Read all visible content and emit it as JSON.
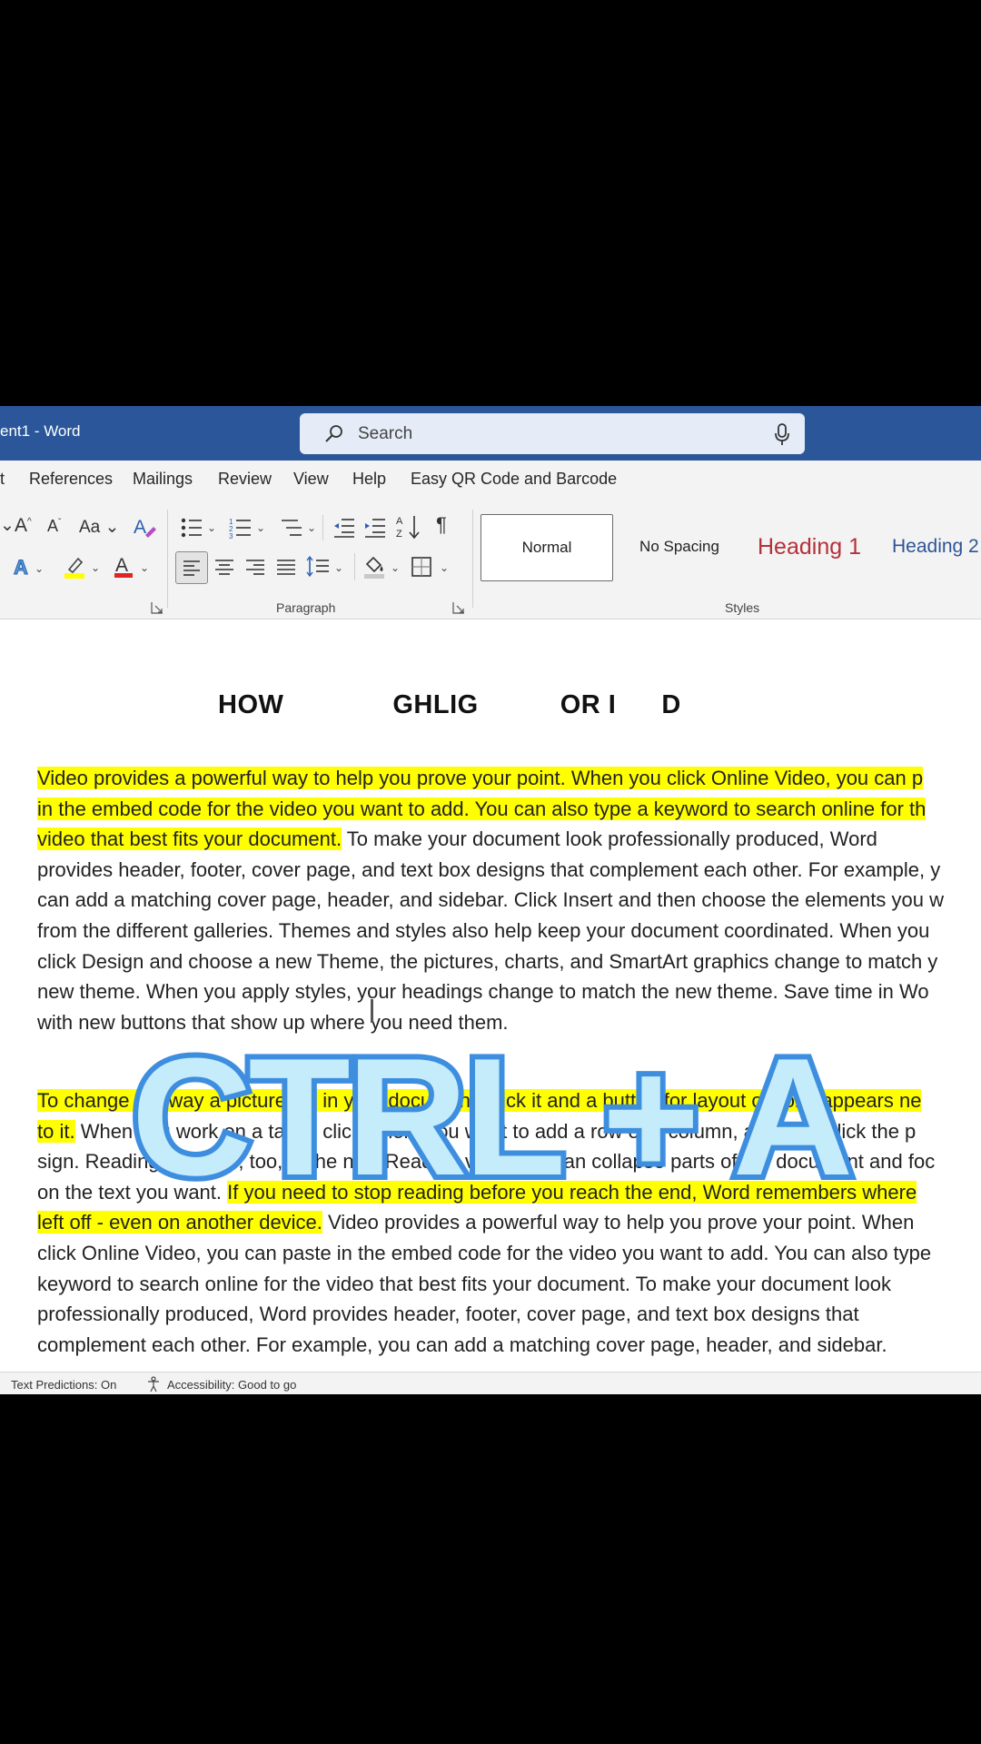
{
  "app": {
    "title": "ent1  -  Word",
    "search_placeholder": "Search"
  },
  "menu": {
    "tabs": [
      "t",
      "References",
      "Mailings",
      "Review",
      "View",
      "Help",
      "Easy QR Code and Barcode"
    ]
  },
  "ribbon": {
    "font_group": {
      "grow_font": "A",
      "shrink_font": "A",
      "change_case": "Aa",
      "font_color_letter": "A"
    },
    "paragraph_label": "Paragraph",
    "styles_label": "Styles",
    "styles": [
      "Normal",
      "No Spacing",
      "Heading 1",
      "Heading 2"
    ]
  },
  "document": {
    "heading_fragments": [
      "HOW",
      "GHLIG",
      "OR I",
      "D"
    ],
    "paragraph1": [
      [
        {
          "t": "Video provides a powerful way to help you prove your point. When you click Online Video, you can p",
          "h": true
        }
      ],
      [
        {
          "t": "in the embed code for the video you want to add. You can also type a keyword to search online for th",
          "h": true
        }
      ],
      [
        {
          "t": "video that best fits your document.",
          "h": true
        },
        {
          "t": " To make your document look professionally produced, Word",
          "h": false
        }
      ],
      [
        {
          "t": "provides header, footer, cover page, and text box designs that complement each other. For example, y",
          "h": false
        }
      ],
      [
        {
          "t": "can add a matching cover page, header, and sidebar. Click Insert and then choose the elements you w",
          "h": false
        }
      ],
      [
        {
          "t": "from the different galleries. Themes and styles also help keep your document coordinated. When you",
          "h": false
        }
      ],
      [
        {
          "t": "click Design and choose a new Theme, the pictures, charts, and SmartArt graphics change to match y",
          "h": false
        }
      ],
      [
        {
          "t": "new theme. When you apply styles, your headings change to match the new theme. Save time in Wo",
          "h": false
        }
      ],
      [
        {
          "t": "with new buttons that show up where you need them.",
          "h": false
        }
      ]
    ],
    "paragraph2": [
      [
        {
          "t": "To change the way a picture fits in your document, click it and a button for layout options appears ne",
          "h": true
        }
      ],
      [
        {
          "t": "to it.",
          "h": true
        },
        {
          "t": " When you work on a table, click where you want to add a row or a column, and then click the p",
          "h": false
        }
      ],
      [
        {
          "t": "sign. Reading is easier, too, in the new Reading view. You can collapse parts of the document and foc",
          "h": false
        }
      ],
      [
        {
          "t": "on the text you want. ",
          "h": false
        },
        {
          "t": "If you need to stop reading before you reach the end, Word remembers where",
          "h": true
        }
      ],
      [
        {
          "t": "left off - even on another device.",
          "h": true
        },
        {
          "t": " Video provides a powerful way to help you prove your point. When",
          "h": false
        }
      ],
      [
        {
          "t": "click Online Video, you can paste in the embed code for the video you want to add. You can also type",
          "h": false
        }
      ],
      [
        {
          "t": "keyword to search online for the video that best fits your document. To make your document look",
          "h": false
        }
      ],
      [
        {
          "t": "professionally produced, Word provides header, footer, cover page, and text box designs that",
          "h": false
        }
      ],
      [
        {
          "t": "complement each other. For example, you can add a matching cover page, header, and sidebar.",
          "h": false
        }
      ]
    ]
  },
  "overlay": {
    "caption": "CTRL + A"
  },
  "statusbar": {
    "text_predictions": "Text Predictions: On",
    "accessibility": "Accessibility: Good to go"
  },
  "colors": {
    "titlebar": "#2b579a",
    "highlight": "#ffff00",
    "heading1": "#b5303a",
    "heading2": "#2f5496",
    "overlay_fill": "#c4ecfb",
    "overlay_stroke": "#3e8ee0"
  }
}
